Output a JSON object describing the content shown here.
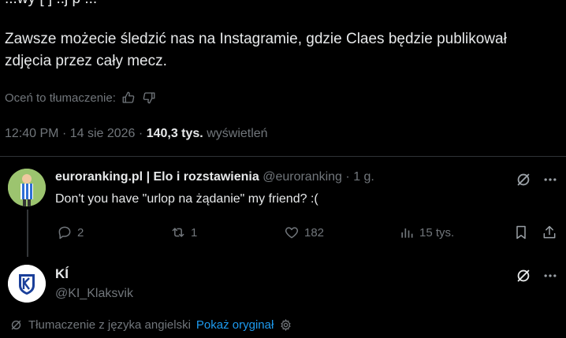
{
  "tweet": {
    "partial_top_line": "...wy [ ] ..j p ...",
    "text": "Zawsze możecie śledzić nas na Instagramie, gdzie Claes będzie publikował zdjęcia przez cały mecz.",
    "rate_label": "Oceń to tłumaczenie:",
    "time": "12:40 PM",
    "date": "14 sie 2026",
    "views_count": "140,3 tys.",
    "views_label": "wyświetleń"
  },
  "reply": {
    "display_name": "euroranking.pl | Elo i rozstawienia",
    "handle": "@euroranking",
    "time": "1 g.",
    "text": "Don't you have \"urlop na żądanie\" my friend? :(",
    "replies": "2",
    "reposts": "1",
    "likes": "182",
    "views": "15 tys."
  },
  "next_tweet": {
    "display_name": "KÍ",
    "handle": "@KI_Klaksvik",
    "translated_label": "Tłumaczenie z języka angielski",
    "show_original": "Pokaż oryginał"
  },
  "colors": {
    "background": "#000000",
    "text": "#e7e9ea",
    "secondary": "#71767b",
    "link": "#1d9bf0",
    "ki_blue": "#1a3f9a"
  },
  "icons": [
    "thumbs-up-icon",
    "thumbs-down-icon",
    "grok-icon",
    "more-icon",
    "reply-icon",
    "repost-icon",
    "like-icon",
    "views-icon",
    "bookmark-icon",
    "share-icon",
    "translate-icon",
    "settings-gear-icon"
  ]
}
